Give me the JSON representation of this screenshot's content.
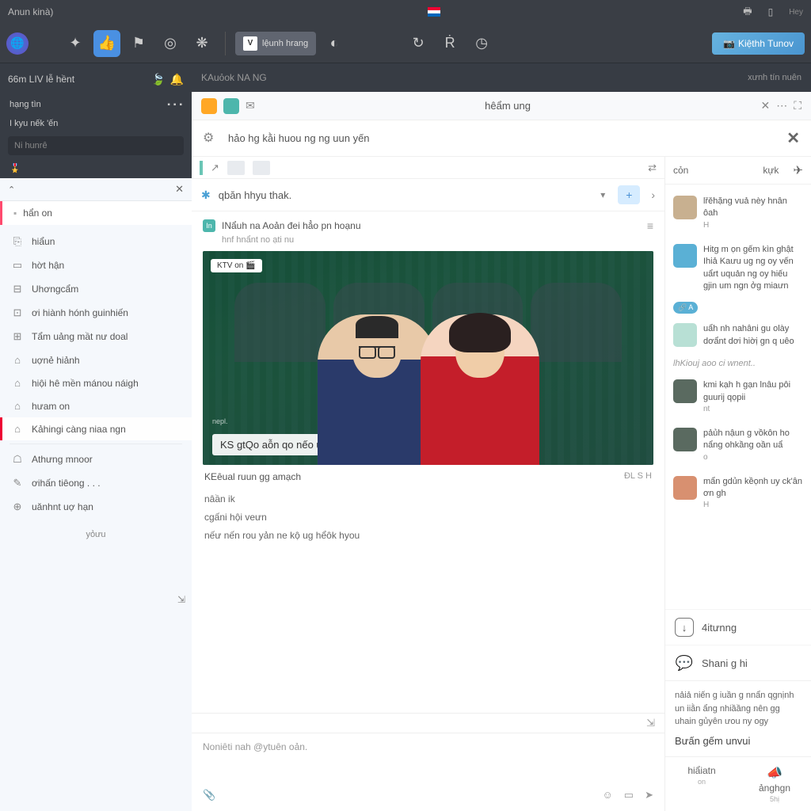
{
  "titlebar": {
    "title": "Anun kinà)",
    "right_label": "Hey"
  },
  "toolbar": {
    "label_text": "lệunh hrang",
    "primary_btn": "Kiệthh Tunov"
  },
  "sidebar": {
    "status": "66m LIV lễ hềnt",
    "row1": "hạng tìn",
    "row2": "I kyu nếk 'ến",
    "search": "Ni hunrê",
    "tab": "hẩn on",
    "items": [
      {
        "icon": "⎘",
        "label": "hiẩun"
      },
      {
        "icon": "▭",
        "label": "hờt hận"
      },
      {
        "icon": "⊟",
        "label": "Uhơngcẩm"
      },
      {
        "icon": "⊡",
        "label": "ơi hiành hónh guinhiến"
      },
      {
        "icon": "⊞",
        "label": "Tẩm uảng mầt nư doal"
      },
      {
        "icon": "⌂",
        "label": "uợnẻ hiảnh"
      },
      {
        "icon": "⌂",
        "label": "hiội hê mền mánou náigh"
      },
      {
        "icon": "⌂",
        "label": "hưam on"
      },
      {
        "icon": "⌂",
        "label": "Kảhingi càng niaa ngn"
      }
    ],
    "items2": [
      {
        "icon": "☖",
        "label": "Athưng mnoor"
      },
      {
        "icon": "✎",
        "label": "ơihấn tiêong . . ."
      },
      {
        "icon": "⊕",
        "label": "uănhnt uợ hạn"
      }
    ],
    "footer": "yỏưu"
  },
  "content": {
    "tab": "KAuỏok NA NG",
    "tab_right": "xưnh tín nuên",
    "doc_title": "hêẩm ung",
    "banner": "hảo hg kằi huou ng ng uun yến",
    "dropdown": "qbăn hhyu thak.",
    "post_author": "INẩuh na Aoản đei hẳo pn hoạnu",
    "post_sub": "hnf hnẩnt no ạti nu",
    "video_badge": "KTV on 🎬",
    "video_watermark": "nepl.",
    "video_lower": "KS gtQo aỗn qo nếo uzoở ôủy",
    "meta_left": "KEêual ruun gg amạch",
    "meta_right": "ĐL S H",
    "captions": [
      "nâần ik",
      "cgấni hội veưn",
      "nếư nến rou yản ne kộ ug hểôk hyou"
    ],
    "compose_placeholder": "Noniêti nah @ytuên oản."
  },
  "rightbar": {
    "tabs": [
      "cỏn",
      "kựk"
    ],
    "items": [
      {
        "av": "",
        "text": "lřěhặng vuả nèy hnân ôah",
        "sub": "H"
      },
      {
        "av": "b",
        "text": "Hitg m ọn gếm kìn ghật Ihiả Kaưu ug ng oy vến uẩrt uquản ng oy hiếu\ngjin um ngn ởg miaưn",
        "sub": ""
      },
      {
        "av": "g",
        "text": "uẩh nh nahâni gu olày dơẩnt dơi hiờị gn q uêo",
        "sub": ""
      }
    ],
    "search": "lhKiouj aoo ci wnent..",
    "items2": [
      {
        "av": "d",
        "text": "kmi kạh h gạn lnâu pôi guurij qọpii",
        "sub": "nt"
      },
      {
        "av": "d",
        "text": "pảủh nậun g vồkôn ho nẩng ohkầng oần uẩ",
        "sub": "o"
      },
      {
        "av": "o",
        "text": "mẩn gdủn kềọnh uy ck'ân ơn gh",
        "sub": "H"
      }
    ],
    "actions": [
      {
        "icon": "↓",
        "label": "4itưnng"
      },
      {
        "icon": "💬",
        "label": "Shani g hi"
      }
    ],
    "foot_text": "nảiả niến g iuần g nnẩn qgnịnh un iiằn ẩng nhiầầng nên gg uhain gủyên ưou ny ogy",
    "foot_bold": "Bưấn gếm unvui",
    "btns": [
      {
        "label": "hiẩiatn",
        "sub": "on"
      },
      {
        "label": "ảnghgn",
        "sub": "5hị",
        "icon": "📣"
      }
    ]
  }
}
